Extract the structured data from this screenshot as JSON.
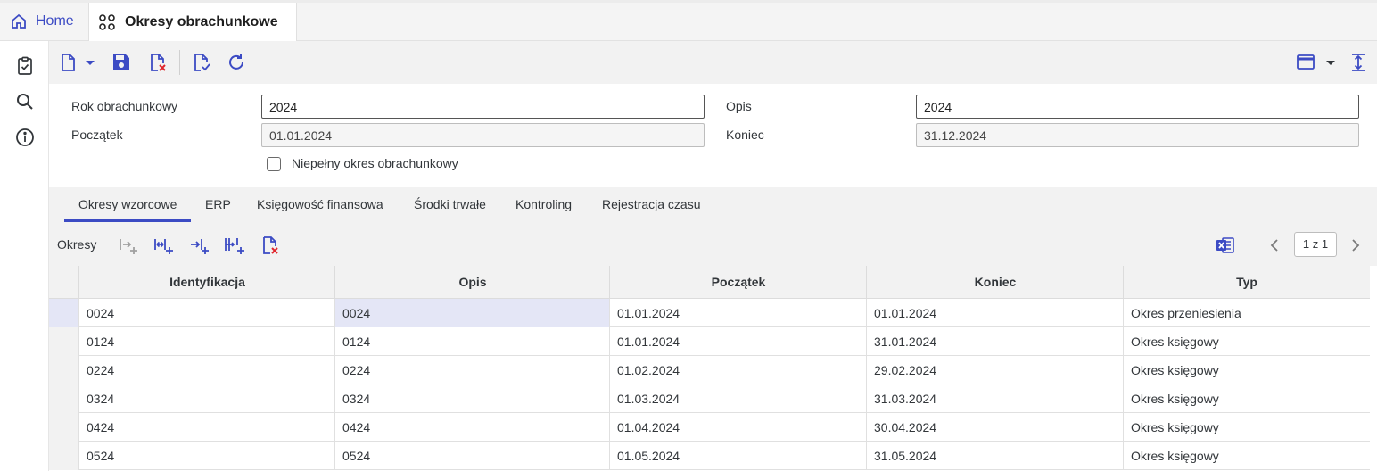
{
  "tabs": {
    "home_label": "Home",
    "active_label": "Okresy obrachunkowe"
  },
  "form": {
    "rok_label": "Rok obrachunkowy",
    "rok_value": "2024",
    "opis_label": "Opis",
    "opis_value": "2024",
    "poczatek_label": "Początek",
    "poczatek_value": "01.01.2024",
    "koniec_label": "Koniec",
    "koniec_value": "31.12.2024",
    "niepelny_label": "Niepełny okres obrachunkowy",
    "niepelny_checked": false
  },
  "panel_tabs": [
    {
      "label": "Okresy wzorcowe",
      "active": true
    },
    {
      "label": "ERP"
    },
    {
      "label": "Księgowość finansowa"
    },
    {
      "label": "Środki trwałe"
    },
    {
      "label": "Kontroling"
    },
    {
      "label": "Rejestracja czasu"
    }
  ],
  "grid": {
    "label": "Okresy",
    "pager": "1 z 1",
    "columns": [
      "Identyfikacja",
      "Opis",
      "Początek",
      "Koniec",
      "Typ"
    ],
    "rows": [
      [
        "0024",
        "0024",
        "01.01.2024",
        "01.01.2024",
        "Okres przeniesienia"
      ],
      [
        "0124",
        "0124",
        "01.01.2024",
        "31.01.2024",
        "Okres księgowy"
      ],
      [
        "0224",
        "0224",
        "01.02.2024",
        "29.02.2024",
        "Okres księgowy"
      ],
      [
        "0324",
        "0324",
        "01.03.2024",
        "31.03.2024",
        "Okres księgowy"
      ],
      [
        "0424",
        "0424",
        "01.04.2024",
        "30.04.2024",
        "Okres księgowy"
      ],
      [
        "0524",
        "0524",
        "01.05.2024",
        "31.05.2024",
        "Okres księgowy"
      ]
    ]
  },
  "icons": {
    "rail": [
      "clipboard-check-icon",
      "search-icon",
      "info-icon"
    ],
    "toolbar": [
      "new-document-icon",
      "save-icon",
      "delete-document-icon",
      "validate-document-icon",
      "refresh-icon",
      "layout-icon",
      "expand-vertical-icon"
    ],
    "grid": [
      "add-row-icon",
      "insert-row-icon",
      "append-row-icon",
      "add-multiple-rows-icon",
      "delete-rows-icon",
      "excel-export-icon"
    ]
  },
  "colors": {
    "accent": "#3c4bc4",
    "delete": "#e0262c",
    "selection": "#e4e6f6"
  }
}
